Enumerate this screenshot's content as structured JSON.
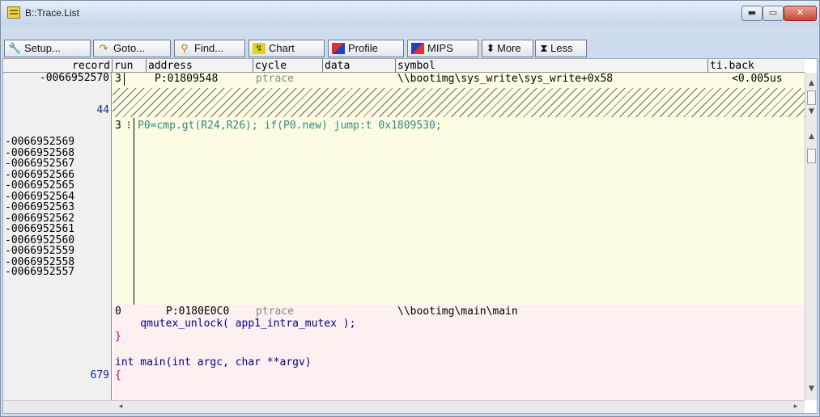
{
  "window": {
    "title": "B::Trace.List",
    "min_label": "▬",
    "max_label": "▭",
    "close_label": "✕"
  },
  "toolbar": {
    "setup": "Setup...",
    "goto": "Goto...",
    "find": "Find...",
    "chart": "Chart",
    "profile": "Profile",
    "mips": "MIPS",
    "more": "More",
    "less": "Less"
  },
  "columns": {
    "record": "record",
    "run": "run",
    "address": "address",
    "cycle": "cycle",
    "data": "data",
    "symbol": "symbol",
    "tiback": "ti.back"
  },
  "records": {
    "r0": "-0066952570",
    "r1": "44",
    "list": [
      "-0066952569",
      "-0066952568",
      "-0066952567",
      "-0066952566",
      "-0066952565",
      "-0066952564",
      "-0066952563",
      "-0066952562",
      "-0066952561",
      "-0066952560",
      "-0066952559",
      "-0066952558"
    ],
    "r_last": "-0066952557",
    "r_679": "679"
  },
  "trace": {
    "row1": {
      "run": "3",
      "address": "P:01809548",
      "cycle": "ptrace",
      "symbol": "\\\\bootimg\\sys_write\\sys_write+0x58",
      "tiback": "<0.005us"
    },
    "row2": {
      "run": "3",
      "instr": "P0=cmp.gt(R24,R26); if(P0.new) jump:t 0x1809530;"
    },
    "row3": {
      "run": "0",
      "address": "P:0180E0C0",
      "cycle": "ptrace",
      "symbol": "\\\\bootimg\\main\\main"
    },
    "src": [
      "    qmutex_unlock( app1_intra_mutex );",
      "}",
      "",
      "int main(int argc, char **argv)",
      "{"
    ]
  },
  "colors": {
    "yellow_bg": "#fdfce2",
    "pink_bg": "#fdf0f0",
    "asm": "#2e8a7d",
    "ptrace": "#888888",
    "source": "#000088",
    "brace": "#c0007a"
  }
}
